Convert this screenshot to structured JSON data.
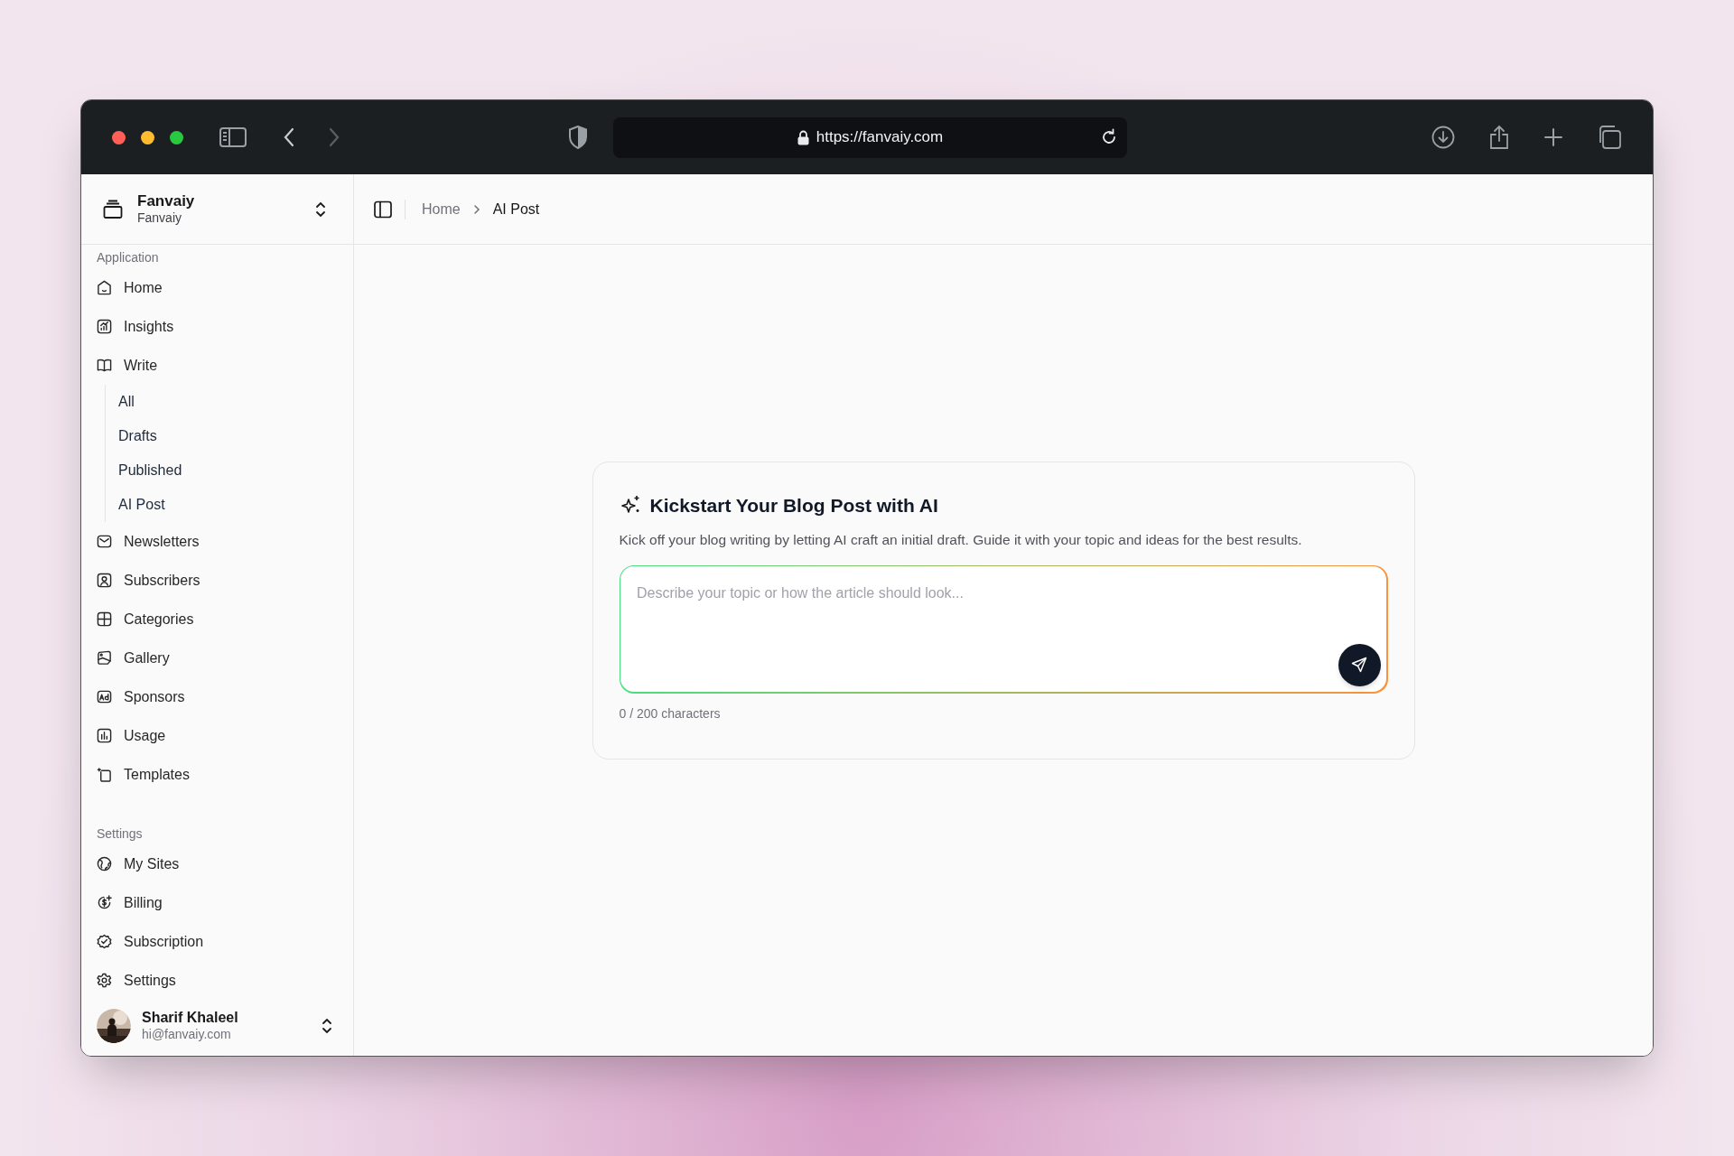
{
  "browser": {
    "url": "https://fanvaiy.com"
  },
  "workspace": {
    "name": "Fanvaiy",
    "subtitle": "Fanvaiy"
  },
  "breadcrumb": [
    "Home",
    "AI Post"
  ],
  "sidebar": {
    "sections": [
      {
        "label": "Application",
        "items": [
          {
            "label": "Home"
          },
          {
            "label": "Insights"
          },
          {
            "label": "Write",
            "children": [
              {
                "label": "All"
              },
              {
                "label": "Drafts"
              },
              {
                "label": "Published"
              },
              {
                "label": "AI Post"
              }
            ]
          },
          {
            "label": "Newsletters"
          },
          {
            "label": "Subscribers"
          },
          {
            "label": "Categories"
          },
          {
            "label": "Gallery"
          },
          {
            "label": "Sponsors"
          },
          {
            "label": "Usage"
          },
          {
            "label": "Templates"
          }
        ]
      },
      {
        "label": "Settings",
        "items": [
          {
            "label": "My Sites"
          },
          {
            "label": "Billing"
          },
          {
            "label": "Subscription"
          },
          {
            "label": "Settings"
          }
        ]
      }
    ]
  },
  "user": {
    "name": "Sharif Khaleel",
    "email": "hi@fanvaiy.com"
  },
  "card": {
    "title": "Kickstart Your Blog Post with AI",
    "description": "Kick off your blog writing by letting AI craft an initial draft. Guide it with your topic and ideas for the best results.",
    "input": {
      "placeholder": "Describe your topic or how the article should look..."
    },
    "counter": "0 / 200 characters"
  }
}
